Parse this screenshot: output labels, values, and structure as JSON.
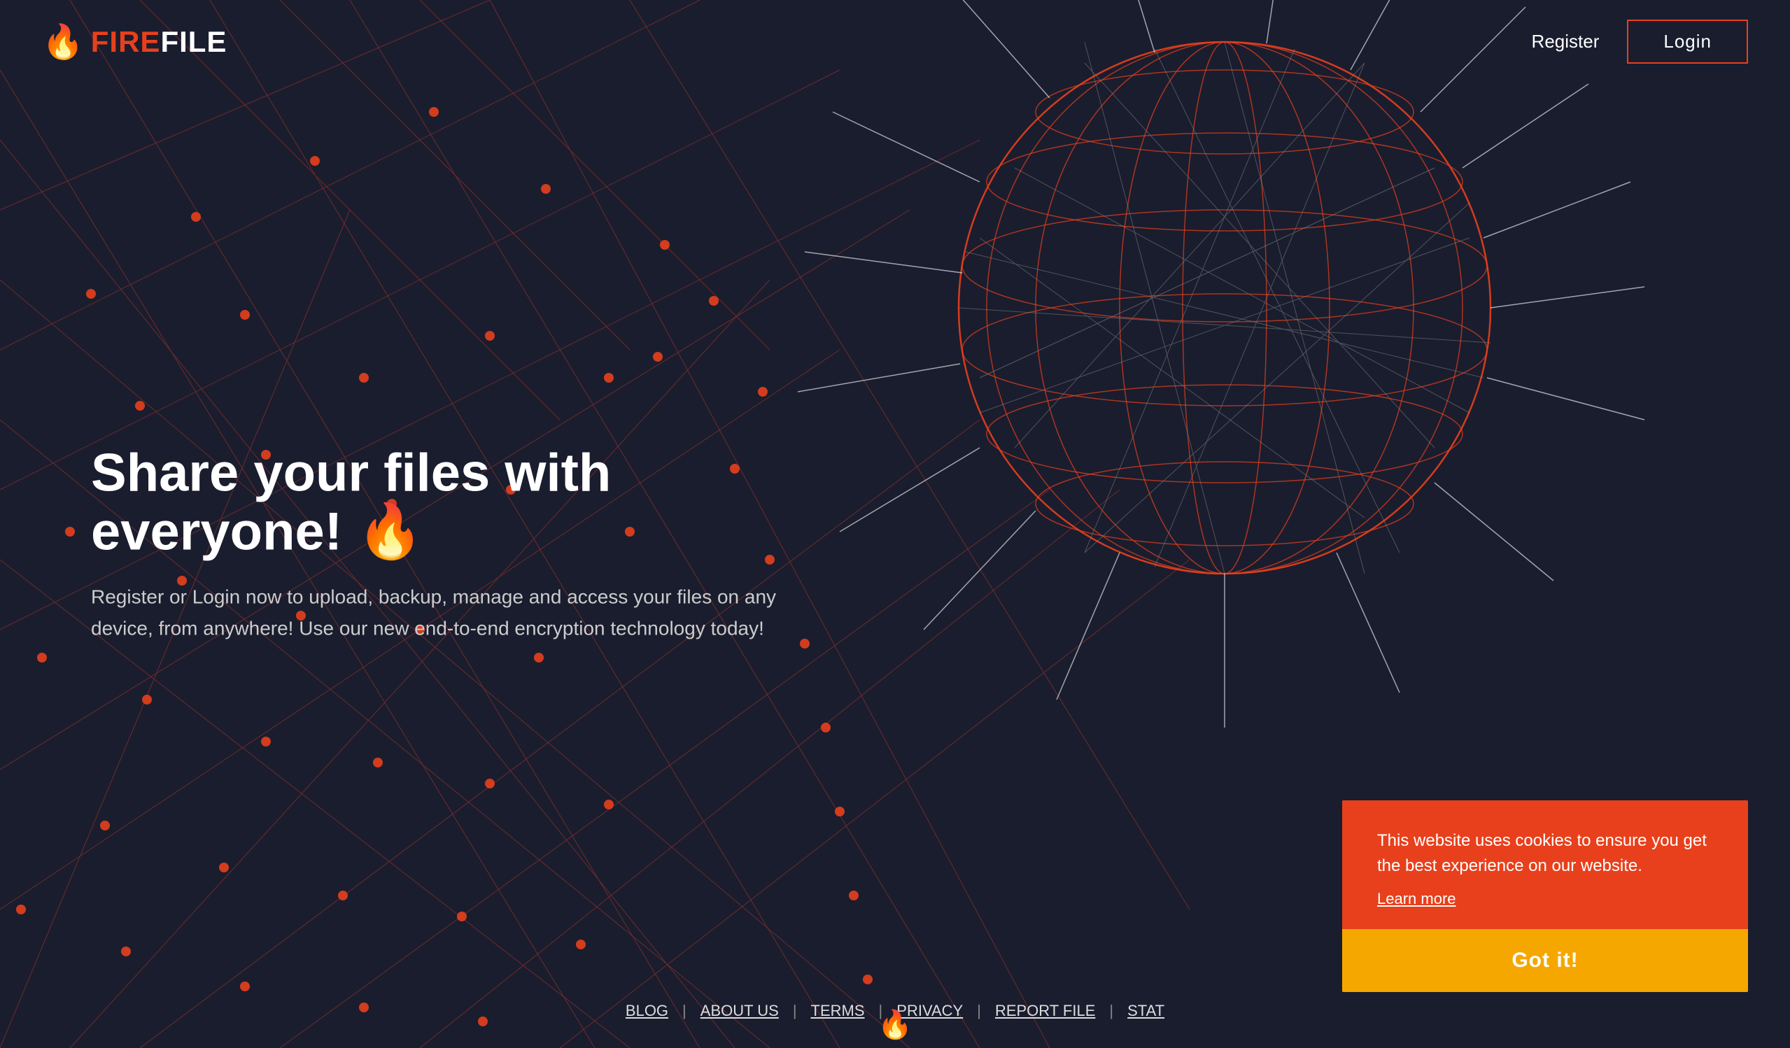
{
  "header": {
    "logo_fire": "FIRE",
    "logo_file": "FILE",
    "logo_flame": "🔥",
    "register_label": "Register",
    "login_label": "Login"
  },
  "hero": {
    "title": "Share your files with everyone! 🔥",
    "subtitle": "Register or Login now to upload, backup, manage and access your files on any device, from anywhere! Use our new end-to-end encryption technology today!"
  },
  "footer": {
    "links": [
      {
        "label": "BLOG"
      },
      {
        "label": "ABOUT US"
      },
      {
        "label": "TERMS"
      },
      {
        "label": "PRIVACY"
      },
      {
        "label": "REPORT FILE"
      },
      {
        "label": "STAT"
      }
    ]
  },
  "cookie": {
    "text": "This website uses cookies to ensure you get the best experience on our website.",
    "learn_more": "Learn more",
    "button_label": "Got it!"
  },
  "colors": {
    "brand_orange": "#e8401c",
    "brand_yellow": "#f5a700",
    "bg_dark": "#1a1d2e",
    "node_color": "#e8401c",
    "grid_color": "#c0392b"
  }
}
